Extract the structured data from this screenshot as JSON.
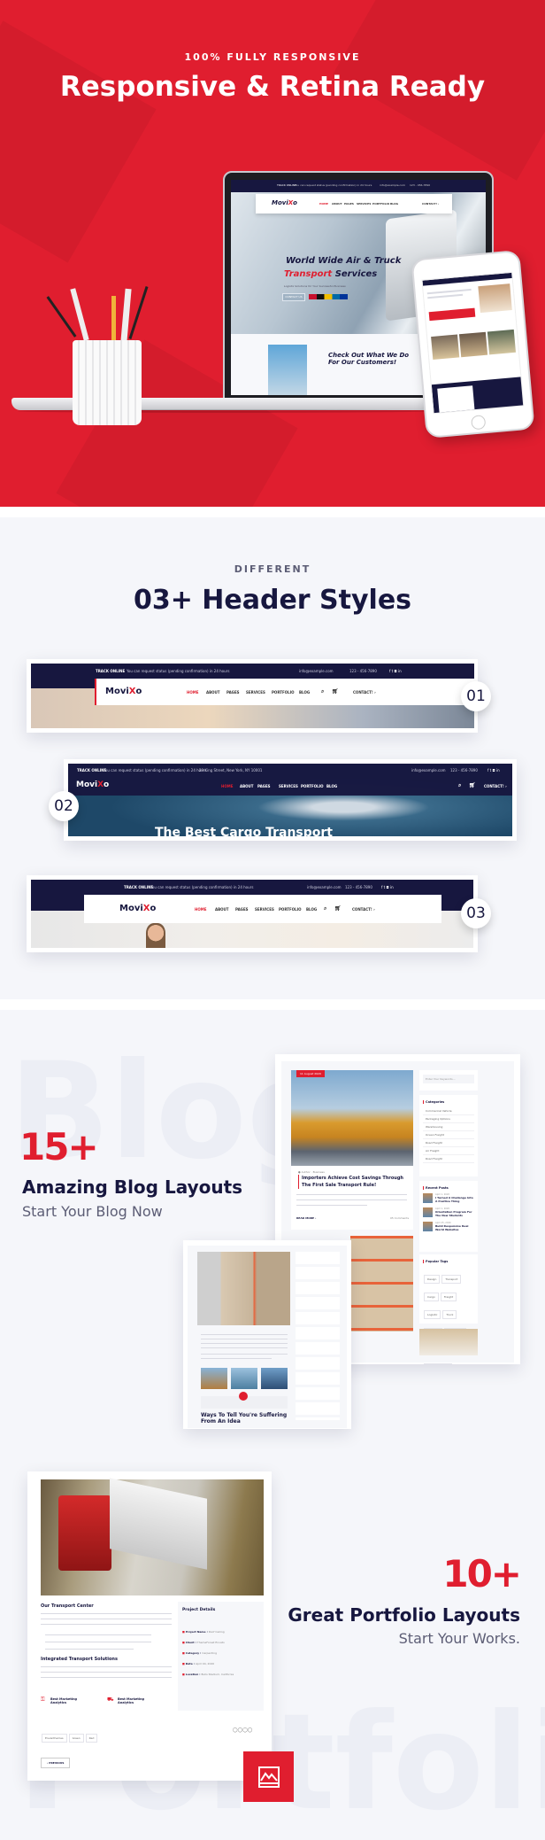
{
  "colors": {
    "accent": "#e01e2f",
    "navy": "#17173f",
    "section_bg": "#f5f6fa"
  },
  "hero": {
    "kicker": "100% FULLY RESPONSIVE",
    "title": "Responsive & Retina Ready",
    "laptop": {
      "topbar_left": "TRACK ONLINE",
      "topbar_msg": "You can request status (pending confirmation) in 24 hours",
      "email": "info@example.com",
      "phone": "123 - 456-7890",
      "logo_a": "Movi",
      "logo_b": "X",
      "logo_c": "o",
      "menu": [
        "HOME",
        "ABOUT",
        "PAGES",
        "SERVICES",
        "PORTFOLIO",
        "BLOG"
      ],
      "contact": "CONTACT! ›",
      "headline_1": "World Wide Air & Truck",
      "headline_2a": "Transport",
      "headline_2b": " Services",
      "subtitle": "Logistic Solutions for Your Successful Business",
      "button": "CONTACT US",
      "section_title": "Check Out What We Do For Our Customers!"
    }
  },
  "headers": {
    "kicker": "DIFFERENT",
    "title": "03+ Header Styles",
    "common": {
      "track": "TRACK ONLINE",
      "msg": "You can request status (pending confirmation) in 24 hours",
      "address": "29 King Street, New York, NY 10001",
      "email": "info@example.com",
      "phone": "123 - 456-7890",
      "logo_a": "Movi",
      "logo_b": "X",
      "logo_c": "o",
      "menu": [
        "HOME",
        "ABOUT",
        "PAGES",
        "SERVICES",
        "PORTFOLIO",
        "BLOG"
      ],
      "contact": "CONTACT! ›",
      "social": [
        "f",
        "t",
        "ig",
        "in"
      ],
      "hero_text": "The Best Cargo Transport"
    },
    "badges": [
      "01",
      "02",
      "03"
    ]
  },
  "blog": {
    "watermark": "Blog",
    "count": "15+",
    "title": "Amazing Blog Layouts",
    "subtitle": "Start Your Blog Now",
    "post": {
      "date": "11 August 2020",
      "author": "Author",
      "category": "Business",
      "title": "Importers Achieve Cost Savings Through The First Sale Transport Rule!",
      "read_more": "READ MORE ›",
      "comments": "05 Comments"
    },
    "search_placeholder": "Enter Your Keywords...",
    "categories_title": "Categories",
    "categories": [
      "Commercial Vehicle",
      "Packaging Options",
      "Warehousing",
      "Ocean Freight",
      "Road Freight",
      "Air Freight",
      "Road Freight"
    ],
    "recent_title": "Recent Posts",
    "recent": [
      {
        "date": "April 1, 2020",
        "title": "I Turned A Challenge Into A Positive Thing"
      },
      {
        "date": "April 1, 2020",
        "title": "Orientation Program For The New Students"
      },
      {
        "date": "April 25, 2020",
        "title": "Build Responsive Real World Websites"
      }
    ],
    "tags_title": "Popular Tags",
    "tags": [
      "Design",
      "Transport",
      "Cargo",
      "Freight",
      "Logistic",
      "Truck",
      "Shipping",
      "Warehouse",
      "Transport Development",
      "Transport Policy"
    ],
    "small_post_title": "Ways To Tell You're Suffering From An Idea"
  },
  "portfolio": {
    "watermark": "Portfolio",
    "count": "10+",
    "title": "Great Portfolio Layouts",
    "subtitle": "Start Your Works.",
    "heading_1": "Our Transport Center",
    "heading_2": "Integrated Transport Solutions",
    "feature_1": "Best Marketing Analytics",
    "feature_2": "Best Marketing Analytics",
    "details_title": "Project Details",
    "details": [
      {
        "label": "Project Name :",
        "value": "Roof Ceiling"
      },
      {
        "label": "Client :",
        "value": "ThemeForest Envato"
      },
      {
        "label": "Category :",
        "value": "Carpenting"
      },
      {
        "label": "Date :",
        "value": "April 04, 2020"
      },
      {
        "label": "Location :",
        "value": "Bulls Stadium, California"
      }
    ],
    "tags": [
      "Envanthemes",
      "Green",
      "Red"
    ],
    "previous": "‹ PREVIOUS",
    "icon": "image-icon"
  }
}
